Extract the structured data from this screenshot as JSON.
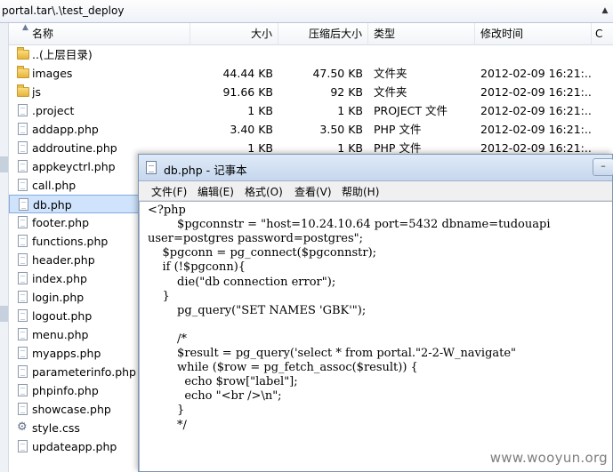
{
  "explorer": {
    "address": "portal.tar\\.\\test_deploy",
    "columns": {
      "name": "名称",
      "size": "大小",
      "packed": "压缩后大小",
      "type": "类型",
      "modified": "修改时间",
      "crc": "C"
    },
    "rows": [
      {
        "icon": "folder-icon",
        "name": "..(上层目录)",
        "size": "",
        "packed": "",
        "type": "",
        "mtime": ""
      },
      {
        "icon": "folder-icon",
        "name": "images",
        "size": "44.44 KB",
        "packed": "47.50 KB",
        "type": "文件夹",
        "mtime": "2012-02-09 16:21:..."
      },
      {
        "icon": "folder-icon",
        "name": "js",
        "size": "91.66 KB",
        "packed": "92 KB",
        "type": "文件夹",
        "mtime": "2012-02-09 16:21:..."
      },
      {
        "icon": "file-icon",
        "name": ".project",
        "size": "1 KB",
        "packed": "1 KB",
        "type": "PROJECT 文件",
        "mtime": "2012-02-09 16:21:..."
      },
      {
        "icon": "file-icon",
        "name": "addapp.php",
        "size": "3.40 KB",
        "packed": "3.50 KB",
        "type": "PHP 文件",
        "mtime": "2012-02-09 16:21:..."
      },
      {
        "icon": "file-icon",
        "name": "addroutine.php",
        "size": "1 KB",
        "packed": "1 KB",
        "type": "PHP 文件",
        "mtime": "2012-02-09 16:21:..."
      },
      {
        "icon": "file-icon",
        "name": "appkeyctrl.php",
        "size": "",
        "packed": "",
        "type": "",
        "mtime": ""
      },
      {
        "icon": "file-icon",
        "name": "call.php",
        "size": "",
        "packed": "",
        "type": "",
        "mtime": ""
      },
      {
        "icon": "file-icon",
        "name": "db.php",
        "size": "",
        "packed": "",
        "type": "",
        "mtime": "",
        "selected": true
      },
      {
        "icon": "file-icon",
        "name": "footer.php",
        "size": "",
        "packed": "",
        "type": "",
        "mtime": ""
      },
      {
        "icon": "file-icon",
        "name": "functions.php",
        "size": "",
        "packed": "",
        "type": "",
        "mtime": ""
      },
      {
        "icon": "file-icon",
        "name": "header.php",
        "size": "",
        "packed": "",
        "type": "",
        "mtime": ""
      },
      {
        "icon": "file-icon",
        "name": "index.php",
        "size": "",
        "packed": "",
        "type": "",
        "mtime": ""
      },
      {
        "icon": "file-icon",
        "name": "login.php",
        "size": "",
        "packed": "",
        "type": "",
        "mtime": ""
      },
      {
        "icon": "file-icon",
        "name": "logout.php",
        "size": "",
        "packed": "",
        "type": "",
        "mtime": ""
      },
      {
        "icon": "file-icon",
        "name": "menu.php",
        "size": "",
        "packed": "",
        "type": "",
        "mtime": ""
      },
      {
        "icon": "file-icon",
        "name": "myapps.php",
        "size": "",
        "packed": "",
        "type": "",
        "mtime": ""
      },
      {
        "icon": "file-icon",
        "name": "parameterinfo.php",
        "size": "",
        "packed": "",
        "type": "",
        "mtime": ""
      },
      {
        "icon": "file-icon",
        "name": "phpinfo.php",
        "size": "",
        "packed": "",
        "type": "",
        "mtime": ""
      },
      {
        "icon": "file-icon",
        "name": "showcase.php",
        "size": "",
        "packed": "",
        "type": "",
        "mtime": ""
      },
      {
        "icon": "gear-icon",
        "name": "style.css",
        "size": "",
        "packed": "",
        "type": "",
        "mtime": ""
      },
      {
        "icon": "file-icon",
        "name": "updateapp.php",
        "size": "",
        "packed": "",
        "type": "",
        "mtime": ""
      }
    ]
  },
  "notepad": {
    "title": "db.php - 记事本",
    "menu": [
      "文件(F)",
      "编辑(E)",
      "格式(O)",
      "查看(V)",
      "帮助(H)"
    ],
    "code_lines": [
      "<?php",
      "        $pgconnstr = \"host=10.24.10.64 port=5432 dbname=tudouapi",
      "user=postgres password=postgres\";",
      "    $pgconn = pg_connect($pgconnstr);",
      "    if (!$pgconn){",
      "        die(\"db connection error\");",
      "    }",
      "        pg_query(\"SET NAMES 'GBK'\");",
      "",
      "        /*",
      "        $result = pg_query('select * from portal.\"2-2-W_navigate\"",
      "        while ($row = pg_fetch_assoc($result)) {",
      "          echo $row[\"label\"];",
      "          echo \"<br />\\n\";",
      "        }",
      "        */"
    ]
  },
  "watermark": "www.wooyun.org"
}
